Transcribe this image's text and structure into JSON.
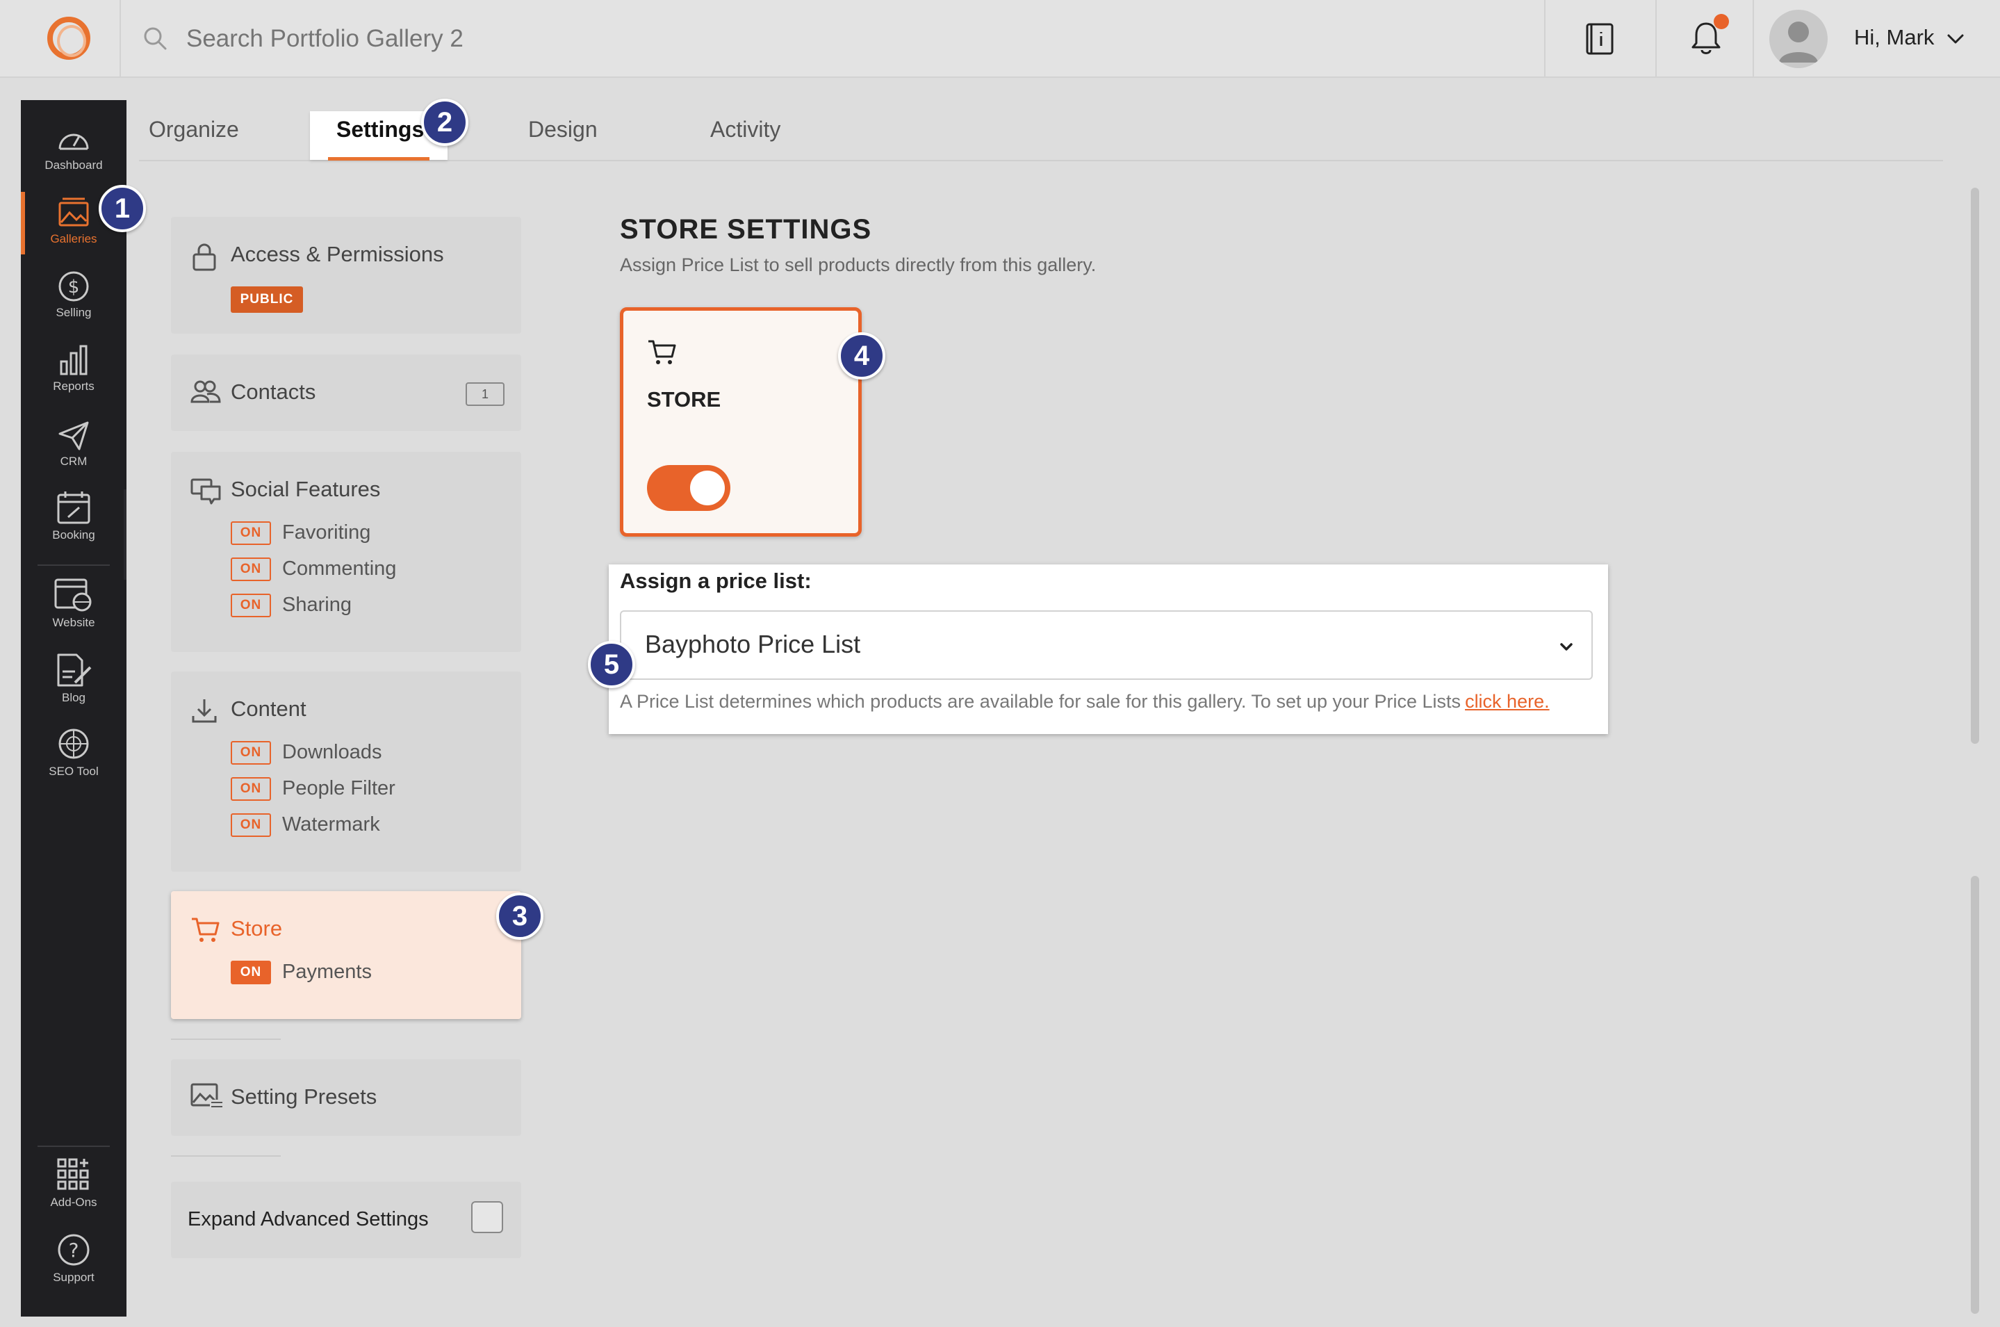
{
  "header": {
    "search_placeholder": "Search Portfolio Gallery 2",
    "greeting": "Hi, Mark",
    "notification_dot_color": "#e8632a"
  },
  "sidebar": {
    "items": [
      {
        "label": "Dashboard",
        "icon": "gauge-icon"
      },
      {
        "label": "Galleries",
        "icon": "gallery-icon",
        "active": true
      },
      {
        "label": "Selling",
        "icon": "dollar-icon"
      },
      {
        "label": "Reports",
        "icon": "bar-chart-icon"
      },
      {
        "label": "CRM",
        "icon": "paper-plane-icon"
      },
      {
        "label": "Booking",
        "icon": "calendar-icon"
      },
      {
        "label": "Website",
        "icon": "website-icon"
      },
      {
        "label": "Blog",
        "icon": "blog-icon"
      },
      {
        "label": "SEO Tool",
        "icon": "seo-globe-icon"
      }
    ],
    "bottom_items": [
      {
        "label": "Add-Ons",
        "icon": "grid-plus-icon"
      },
      {
        "label": "Support",
        "icon": "question-icon"
      }
    ]
  },
  "tabs": [
    {
      "label": "Organize"
    },
    {
      "label": "Settings",
      "active": true
    },
    {
      "label": "Design"
    },
    {
      "label": "Activity"
    }
  ],
  "settings_menu": {
    "access": {
      "title": "Access & Permissions",
      "badge": "PUBLIC"
    },
    "contacts": {
      "title": "Contacts",
      "count": "1"
    },
    "social": {
      "title": "Social Features",
      "items": [
        {
          "state": "ON",
          "label": "Favoriting"
        },
        {
          "state": "ON",
          "label": "Commenting"
        },
        {
          "state": "ON",
          "label": "Sharing"
        }
      ]
    },
    "content": {
      "title": "Content",
      "items": [
        {
          "state": "ON",
          "label": "Downloads"
        },
        {
          "state": "ON",
          "label": "People Filter"
        },
        {
          "state": "ON",
          "label": "Watermark"
        }
      ]
    },
    "store": {
      "title": "Store",
      "items": [
        {
          "state": "ON",
          "label": "Payments"
        }
      ]
    },
    "presets": {
      "title": "Setting Presets"
    },
    "advanced": {
      "label": "Expand Advanced Settings",
      "checked": false
    }
  },
  "store_settings": {
    "heading": "STORE SETTINGS",
    "description": "Assign Price List to sell products directly from this gallery.",
    "tile_label": "STORE",
    "toggle_on": true,
    "price_list_label": "Assign a price list:",
    "price_list_value": "Bayphoto Price List",
    "help_text": "A Price List determines which products are available for sale for this gallery. To set up your Price Lists",
    "help_link": "click here."
  },
  "step_markers": [
    "1",
    "2",
    "3",
    "4",
    "5"
  ],
  "colors": {
    "accent": "#e8632a",
    "sidebar_bg": "#1f1f22",
    "step_marker": "#2f3a86"
  }
}
